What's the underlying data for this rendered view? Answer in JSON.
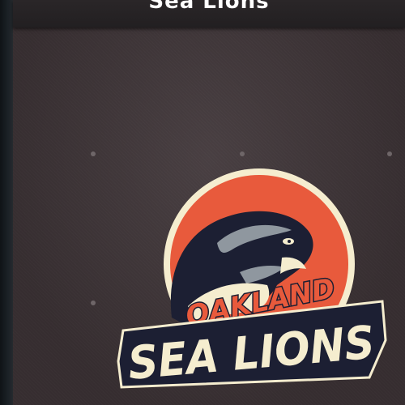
{
  "header": {
    "title": "Sea Lions"
  },
  "logo": {
    "icon": "sea-lion-mascot-icon",
    "line1": "OAKLAND",
    "line2": "SEA LIONS",
    "colors": {
      "circle": "#e85a3c",
      "cream": "#f5edcf",
      "navy": "#1c1f33",
      "gray": "#8f979f"
    }
  }
}
